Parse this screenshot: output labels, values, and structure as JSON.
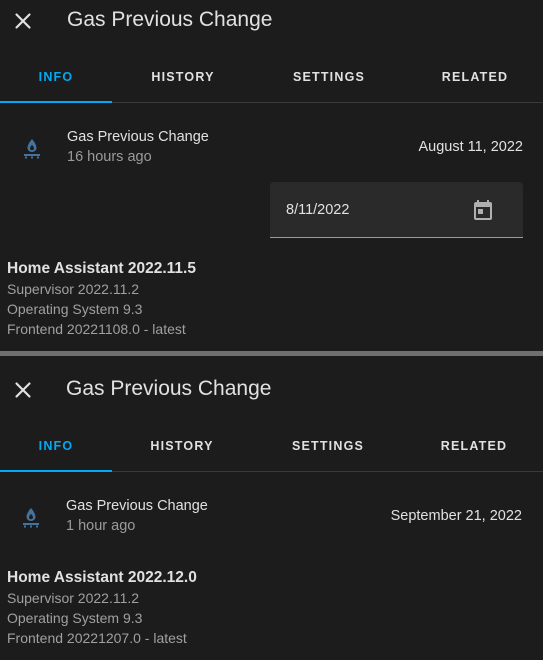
{
  "panels": [
    {
      "title": "Gas Previous Change",
      "tabs": [
        "INFO",
        "HISTORY",
        "SETTINGS",
        "RELATED"
      ],
      "active_tab": "INFO",
      "entity": {
        "icon": "gas-burner-icon",
        "name": "Gas Previous Change",
        "relative_time": "16 hours ago",
        "date": "August 11, 2022"
      },
      "date_input": {
        "value": "8/11/2022",
        "icon": "calendar-icon"
      },
      "version": {
        "main": "Home Assistant 2022.11.5",
        "supervisor": "Supervisor 2022.11.2",
        "os": "Operating System 9.3",
        "frontend": "Frontend 20221108.0 - latest"
      }
    },
    {
      "title": "Gas Previous Change",
      "tabs": [
        "INFO",
        "HISTORY",
        "SETTINGS",
        "RELATED"
      ],
      "active_tab": "INFO",
      "entity": {
        "icon": "gas-burner-icon",
        "name": "Gas Previous Change",
        "relative_time": "1 hour ago",
        "date": "September 21, 2022"
      },
      "version": {
        "main": "Home Assistant 2022.12.0",
        "supervisor": "Supervisor 2022.11.2",
        "os": "Operating System 9.3",
        "frontend": "Frontend 20221207.0 - latest"
      }
    }
  ],
  "colors": {
    "background": "#1c1c1c",
    "accent": "#03a9f4",
    "icon": "#44739e",
    "text_primary": "#e1e1e1",
    "text_secondary": "#9b9b9b"
  }
}
